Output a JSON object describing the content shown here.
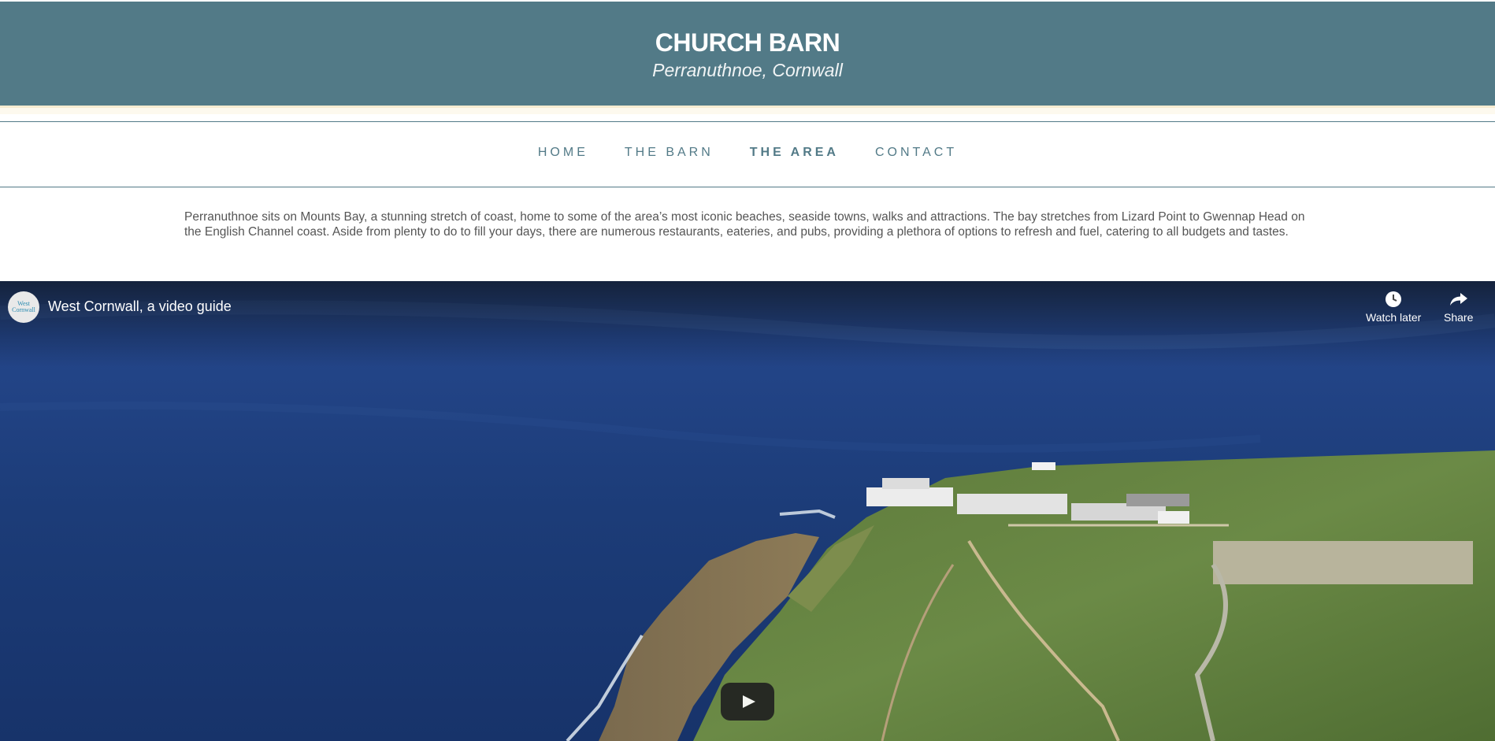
{
  "site": {
    "title": "CHURCH BARN",
    "subtitle": "Perranuthnoe, Cornwall"
  },
  "nav": {
    "items": [
      {
        "label": "HOME",
        "active": false
      },
      {
        "label": "THE BARN",
        "active": false
      },
      {
        "label": "THE AREA",
        "active": true
      },
      {
        "label": "CONTACT",
        "active": false
      }
    ]
  },
  "intro": {
    "text": "Perranuthnoe sits on Mounts Bay, a stunning stretch of coast, home to some of the area’s most iconic beaches, seaside towns, walks and attractions. The bay stretches from Lizard Point to Gwennap Head on the English Channel coast. Aside from plenty to do to fill your days, there are numerous restaurants, eateries, and pubs, providing a plethora of options to refresh and fuel, catering to all budgets and tastes."
  },
  "video": {
    "title": "West Cornwall, a video guide",
    "channel_logo_line1": "West",
    "channel_logo_line2": "Cornwall",
    "watch_later_label": "Watch later",
    "share_label": "Share",
    "icons": {
      "watch_later": "clock-icon",
      "share": "share-arrow-icon",
      "play": "play-icon"
    }
  },
  "colors": {
    "header_bg": "#527a87",
    "nav_text": "#527a87",
    "body_text": "#555555",
    "stripe": "#f6ecd1"
  }
}
